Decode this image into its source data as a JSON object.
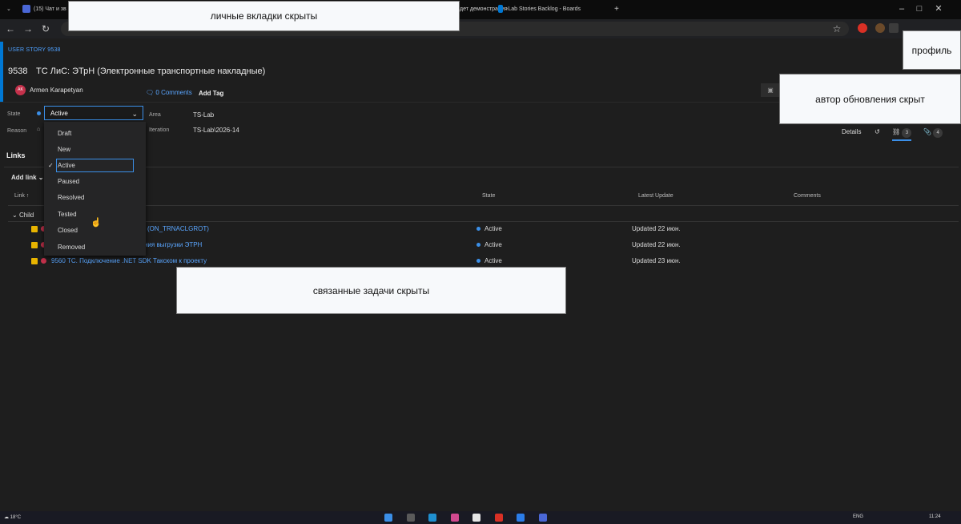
{
  "browser": {
    "tab1": "(15) Чат и зв",
    "tab2_tail": "дет демонстрация",
    "tab3": "-Lab Stories Backlog - Boards",
    "new_tab": "+",
    "minimize": "–",
    "maximize": "□",
    "close": "✕"
  },
  "masks": {
    "tabs": "личные вкладки скрыты",
    "profile": "профиль",
    "author": "автор обновления скрыт",
    "links": "связанные задачи скрыты"
  },
  "work_item": {
    "type_label": "USER STORY 9538",
    "id": "9538",
    "title": "ТС ЛиС: ЭТрН (Электронные транспортные накладные)",
    "avatar_initials": "AK",
    "author": "Armen Karapetyan",
    "comments": "0 Comments",
    "add_tag": "Add Tag",
    "fields": {
      "state_label": "State",
      "state_value": "Active",
      "reason_label": "Reason",
      "area_label": "Area",
      "area_value": "TS-Lab",
      "iteration_label": "Iteration",
      "iteration_value": "TS-Lab\\2026-14"
    },
    "state_options": [
      "Draft",
      "New",
      "Active",
      "Paused",
      "Resolved",
      "Tested",
      "Closed",
      "Removed"
    ],
    "selected_state": "Active"
  },
  "right_tabs": {
    "details": "Details",
    "links_count": "3",
    "attachments_count": "4"
  },
  "links": {
    "title": "Links",
    "add_link": "Add link",
    "columns": {
      "link": "Link ↑",
      "state": "State",
      "latest_update": "Latest Update",
      "comments": "Comments"
    },
    "group": "Child",
    "rows": [
      {
        "title": "l (ON_TRNACLGROT)",
        "state": "Active",
        "updated": "Updated 22 июн."
      },
      {
        "title": "ния выгрузки ЭТРН",
        "state": "Active",
        "updated": "Updated 22 июн."
      },
      {
        "title": "9560 ТС. Подключение .NET SDK Такском к проекту",
        "state": "Active",
        "updated": "Updated 23 июн."
      }
    ]
  },
  "taskbar": {
    "temp": "18°C",
    "lang": "ENG",
    "time": "11:24"
  }
}
